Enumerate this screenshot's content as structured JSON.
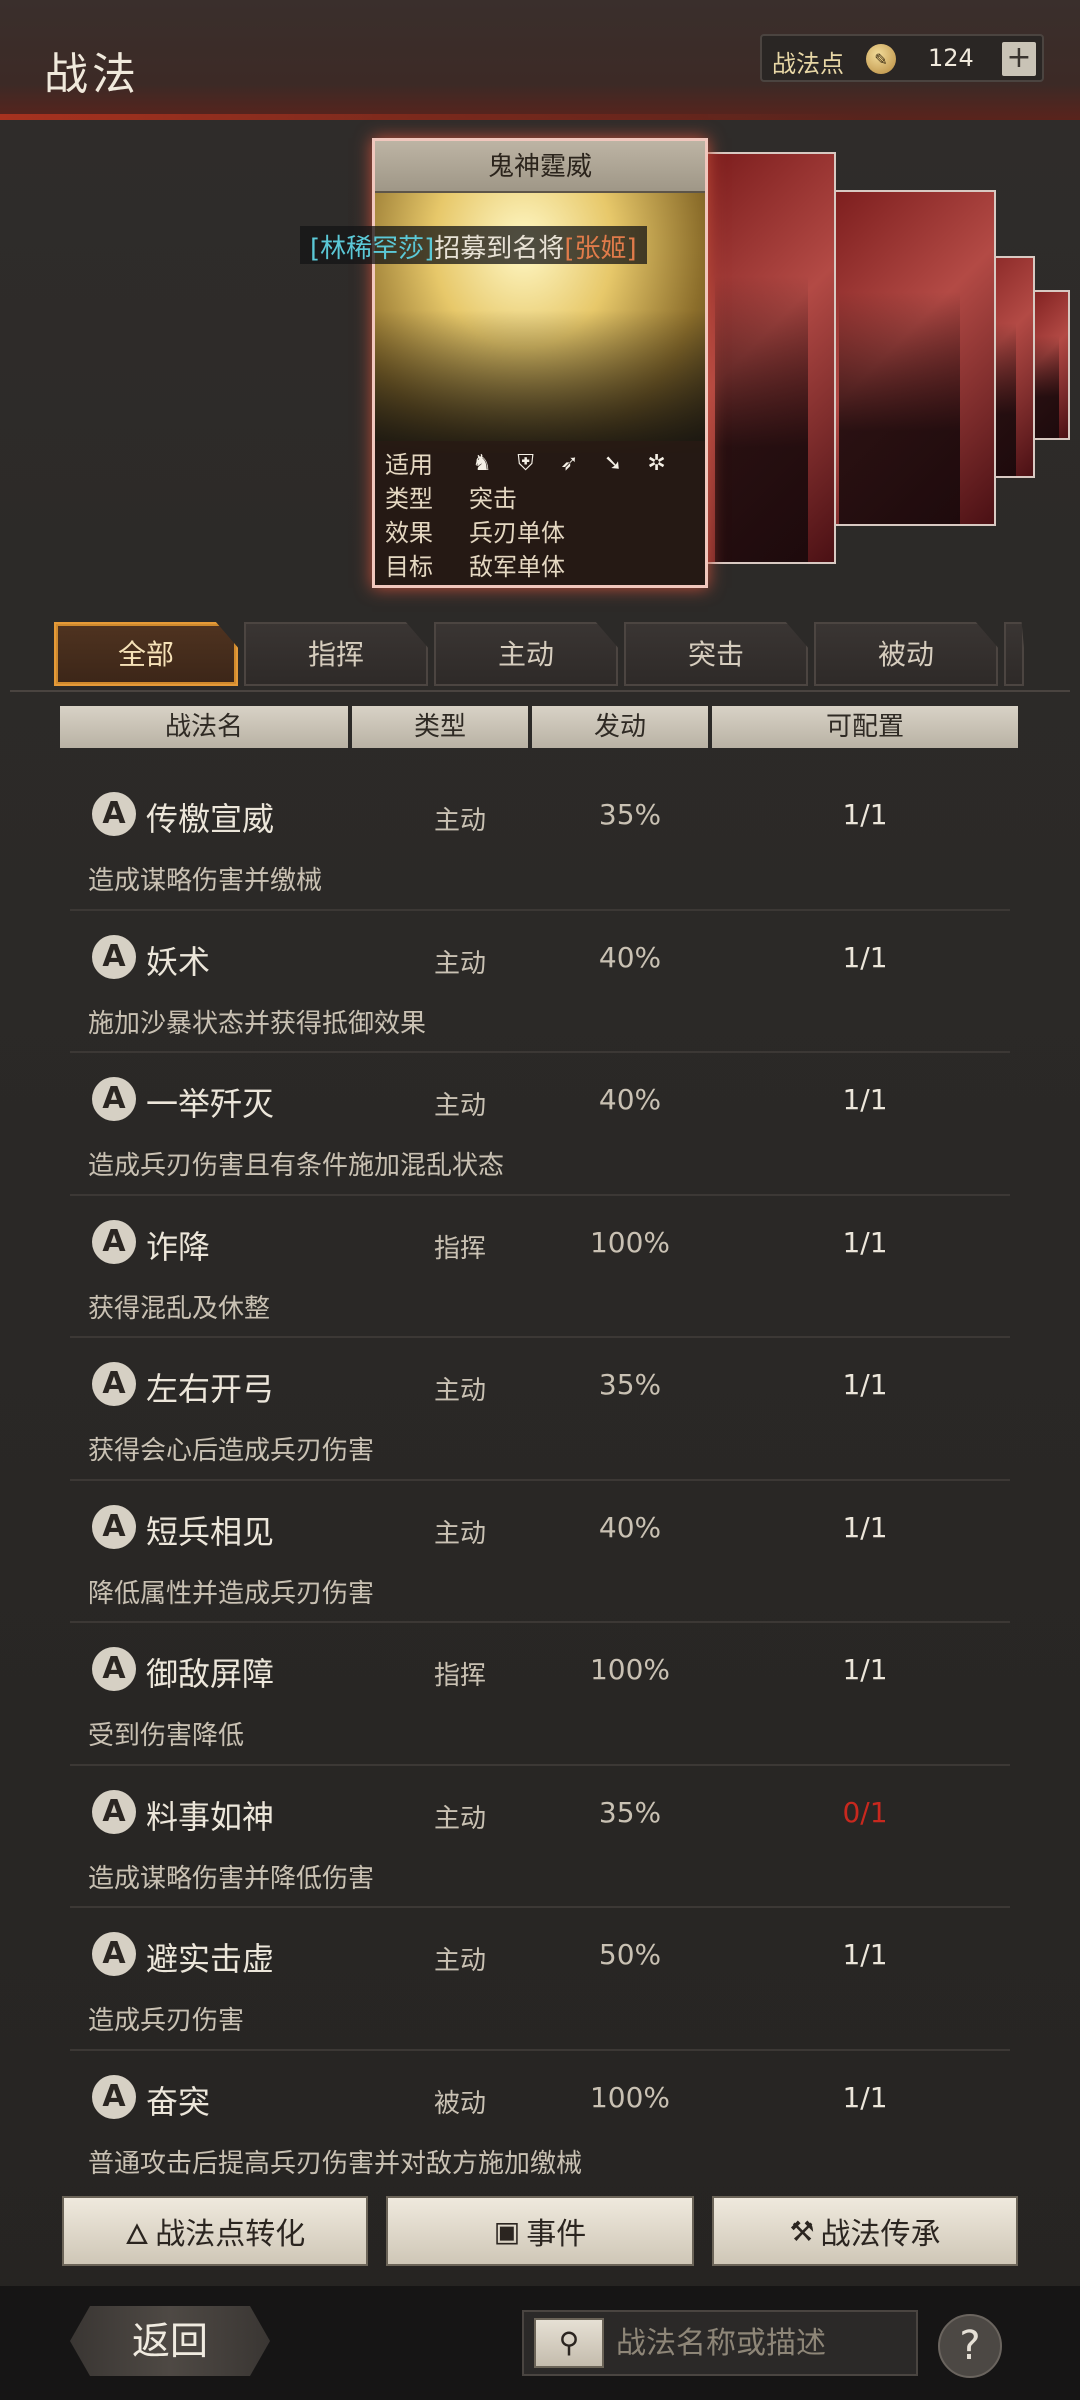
{
  "header": {
    "title": "战法",
    "points_label": "战法点",
    "points_value": "124",
    "plus": "+"
  },
  "card": {
    "name": "鬼神霆威",
    "info": [
      {
        "key": "适用",
        "value": ""
      },
      {
        "key": "类型",
        "value": "突击"
      },
      {
        "key": "效果",
        "value": "兵刃单体"
      },
      {
        "key": "目标",
        "value": "敌军单体"
      }
    ],
    "troop_icons": [
      "cavalry-icon",
      "shield-icon",
      "bow-icon",
      "spear-icon",
      "wheel-icon"
    ]
  },
  "recruit": {
    "player": "[林稀罕莎]",
    "middle": "招募到名将",
    "general": "[张姬]"
  },
  "tabs": [
    "全部",
    "指挥",
    "主动",
    "突击",
    "被动"
  ],
  "columns": [
    "战法名",
    "类型",
    "发动",
    "可配置"
  ],
  "skills": [
    {
      "badge": "A",
      "name": "传檄宣威",
      "type": "主动",
      "rate": "35%",
      "config": "1/1",
      "desc": "造成谋略伤害并缴械"
    },
    {
      "badge": "A",
      "name": "妖术",
      "type": "主动",
      "rate": "40%",
      "config": "1/1",
      "desc": "施加沙暴状态并获得抵御效果"
    },
    {
      "badge": "A",
      "name": "一举歼灭",
      "type": "主动",
      "rate": "40%",
      "config": "1/1",
      "desc": "造成兵刃伤害且有条件施加混乱状态"
    },
    {
      "badge": "A",
      "name": "诈降",
      "type": "指挥",
      "rate": "100%",
      "config": "1/1",
      "desc": "获得混乱及休整"
    },
    {
      "badge": "A",
      "name": "左右开弓",
      "type": "主动",
      "rate": "35%",
      "config": "1/1",
      "desc": "获得会心后造成兵刃伤害"
    },
    {
      "badge": "A",
      "name": "短兵相见",
      "type": "主动",
      "rate": "40%",
      "config": "1/1",
      "desc": "降低属性并造成兵刃伤害"
    },
    {
      "badge": "A",
      "name": "御敌屏障",
      "type": "指挥",
      "rate": "100%",
      "config": "1/1",
      "desc": "受到伤害降低"
    },
    {
      "badge": "A",
      "name": "料事如神",
      "type": "主动",
      "rate": "35%",
      "config": "0/1",
      "desc": "造成谋略伤害并降低伤害"
    },
    {
      "badge": "A",
      "name": "避实击虚",
      "type": "主动",
      "rate": "50%",
      "config": "1/1",
      "desc": "造成兵刃伤害"
    },
    {
      "badge": "A",
      "name": "奋突",
      "type": "被动",
      "rate": "100%",
      "config": "1/1",
      "desc": "普通攻击后提高兵刃伤害并对敌方施加缴械"
    }
  ],
  "buttons": {
    "convert": "战法点转化",
    "event": "事件",
    "inherit": "战法传承"
  },
  "footer": {
    "back": "返回",
    "search_placeholder": "战法名称或描述",
    "help": "?"
  },
  "colors": {
    "accent_orange": "#e59a38",
    "highlight_red": "#c8281e",
    "player_cyan": "#5bc8d6",
    "general_orange": "#e07b4a"
  }
}
